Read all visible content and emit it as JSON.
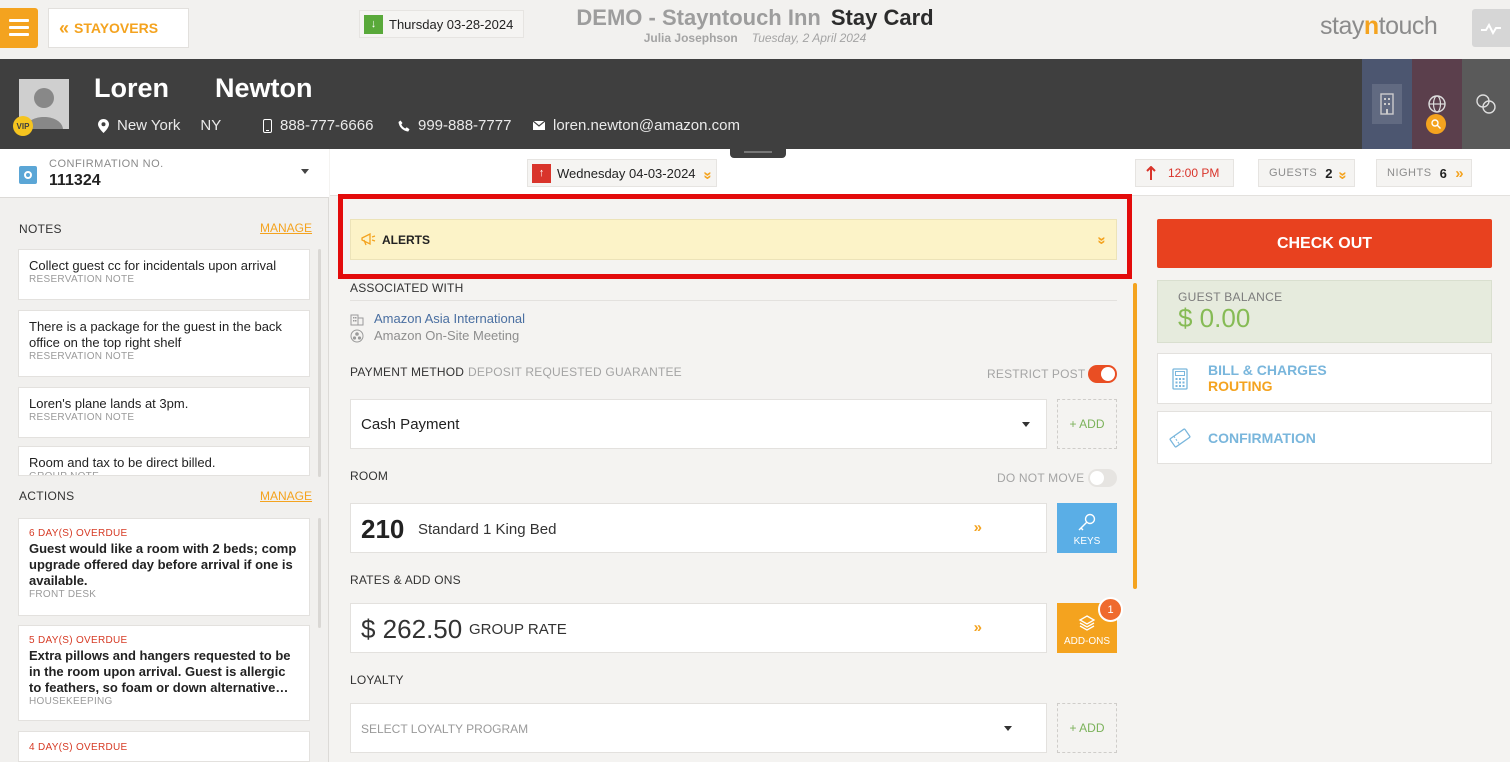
{
  "topbar": {
    "back_label": "STAYOVERS",
    "hotel_title": "DEMO - Stayntouch Inn",
    "page_title": "Stay Card",
    "user": "Julia Josephson",
    "date": "Tuesday, 2 April 2024",
    "logo_prefix": "stay",
    "logo_accent": "n",
    "logo_suffix": "touch"
  },
  "guest": {
    "first_name": "Loren",
    "last_name": "Newton",
    "vip_label": "VIP",
    "city": "New York",
    "state": "NY",
    "mobile": "888-777-6666",
    "phone": "999-888-7777",
    "email": "loren.newton@amazon.com"
  },
  "reservation": {
    "confirmation_label": "CONFIRMATION NO.",
    "confirmation_no": "111324",
    "arrival": "Thursday 03-28-2024",
    "departure": "Wednesday 04-03-2024",
    "departure_time": "12:00 PM",
    "guests_label": "GUESTS",
    "guests": "2",
    "nights_label": "NIGHTS",
    "nights": "6"
  },
  "notes": {
    "title": "NOTES",
    "manage": "MANAGE",
    "items": [
      {
        "text": "Collect guest cc for incidentals upon arrival",
        "type": "RESERVATION NOTE"
      },
      {
        "text": "There is a package for the guest in the back office on the top right shelf",
        "type": "RESERVATION NOTE"
      },
      {
        "text": "Loren's plane lands at 3pm.",
        "type": "RESERVATION NOTE"
      },
      {
        "text": "Room and tax to be direct billed.",
        "type": "GROUP NOTE"
      }
    ]
  },
  "actions": {
    "title": "ACTIONS",
    "manage": "MANAGE",
    "items": [
      {
        "status": "6 DAY(S) OVERDUE",
        "text": "Guest would like a room with 2 beds; comp upgrade offered day before arrival if one is available.",
        "dept": "FRONT DESK"
      },
      {
        "status": "5 DAY(S) OVERDUE",
        "text": "Extra pillows and hangers requested to be in the room upon arrival. Guest is allergic to feathers, so foam or down alternative…",
        "dept": "HOUSEKEEPING"
      },
      {
        "status": "4 DAY(S) OVERDUE"
      }
    ]
  },
  "alerts": {
    "label": "ALERTS"
  },
  "associated": {
    "label": "ASSOCIATED WITH",
    "company": "Amazon Asia International",
    "group": "Amazon On-Site Meeting"
  },
  "payment": {
    "label": "PAYMENT METHOD",
    "sub_label": "DEPOSIT REQUESTED GUARANTEE",
    "restrict_label": "RESTRICT POST",
    "restrict_on": true,
    "method": "Cash Payment",
    "add_label": "+ ADD"
  },
  "room": {
    "label": "ROOM",
    "do_not_move_label": "DO NOT MOVE",
    "do_not_move_on": false,
    "number": "210",
    "type": "Standard 1 King Bed",
    "keys_label": "KEYS"
  },
  "rates": {
    "label": "RATES & ADD ONS",
    "amount": "$ 262.50",
    "name": "GROUP RATE",
    "addons_label": "ADD-ONS",
    "addons_count": "1"
  },
  "loyalty": {
    "label": "LOYALTY",
    "placeholder": "SELECT LOYALTY PROGRAM",
    "add_label": "+ ADD"
  },
  "right": {
    "checkout_label": "CHECK OUT",
    "balance_label": "GUEST BALANCE",
    "balance_value": "$ 0.00",
    "bill_label": "BILL & CHARGES",
    "routing_label": "ROUTING",
    "confirmation_label": "CONFIRMATION"
  },
  "colors": {
    "accent": "#f4a31f",
    "checkout": "#e8411f",
    "alert_bg": "#fcf3c8",
    "highlight": "#e30b0b",
    "header_bg": "#3f3f3f"
  },
  "icons": [
    "menu-icon",
    "chevrons-left-icon",
    "pulse-icon",
    "location-pin-icon",
    "mobile-icon",
    "phone-icon",
    "mail-icon",
    "building-icon",
    "globe-icon",
    "circles-icon",
    "search-icon",
    "target-icon",
    "arrow-down-icon",
    "arrow-up-icon",
    "chevrons-icon",
    "megaphone-icon",
    "company-icon",
    "group-icon",
    "key-icon",
    "layers-icon",
    "calculator-icon",
    "ticket-icon"
  ]
}
